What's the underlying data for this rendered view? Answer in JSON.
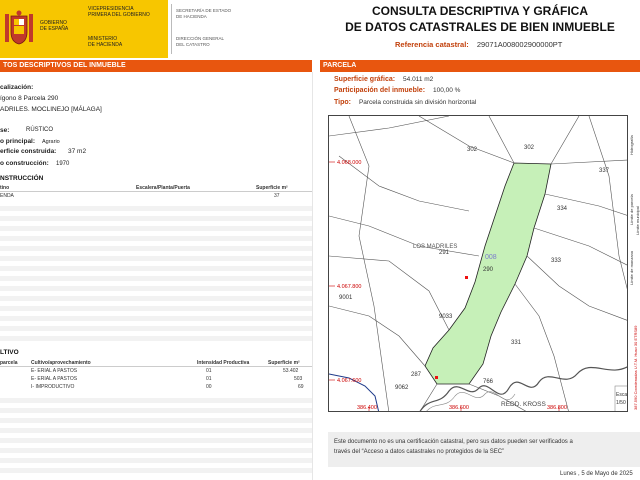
{
  "header": {
    "gov_line1": "GOBIERNO",
    "gov_line2": "DE ESPAÑA",
    "vice_line1": "VICEPRESIDENCIA",
    "vice_line2": "PRIMERA DEL GOBIERNO",
    "ministry_line1": "MINISTERIO",
    "ministry_line2": "DE HACIENDA",
    "sec_line1": "SECRETARÍA DE ESTADO",
    "sec_line2": "DE HACIENDA",
    "dir_line1": "DIRECCIÓN GENERAL",
    "dir_line2": "DEL CATASTRO",
    "title_line1": "CONSULTA DESCRIPTIVA Y GRÁFICA",
    "title_line2": "DE DATOS CATASTRALES DE BIEN INMUEBLE",
    "ref_label": "Referencia catastral:",
    "ref_value": "29071A008002900000PT",
    "brand_color": "#f7c600",
    "accent_color": "#e8560f"
  },
  "left": {
    "section_title": "TOS DESCRIPTIVOS DEL INMUEBLE",
    "location_label": "calización:",
    "location_line1": "ígono 8 Parcela 290",
    "location_line2": "ADRILES. MOCLINEJO [MÁLAGA]",
    "class_label": "se:",
    "class_value": "RÚSTICO",
    "use_label": "o principal:",
    "use_value": "Agrario",
    "area_label": "erficie construida:",
    "area_value": "37 m2",
    "year_label": "o construcción:",
    "year_value": "1970",
    "construction_title": "NSTRUCCIÓN",
    "construction_headers": [
      "tino",
      "Escalera/Planta/Puerta",
      "Superficie m²"
    ],
    "construction_rows": [
      [
        "ENDA",
        "",
        "37"
      ]
    ],
    "crop_title": "LTIVO",
    "crop_headers": [
      "parcela",
      "Cultivo/aprovechamiento",
      "Intensidad Productiva",
      "Superficie m²"
    ],
    "crop_rows": [
      [
        "",
        "E- ERIAL A PASTOS",
        "01",
        "53.402"
      ],
      [
        "",
        "E- ERIAL A PASTOS",
        "01",
        "503"
      ],
      [
        "",
        "I- IMPRODUCTIVO",
        "00",
        "69"
      ]
    ]
  },
  "right": {
    "section_title": "PARCELA",
    "graphic_area_label": "Superficie gráfica:",
    "graphic_area_value": "54.011 m2",
    "participation_label": "Participación del inmueble:",
    "participation_value": "100,00 %",
    "type_label": "Tipo:",
    "type_value": "Parcela construida sin división horizontal"
  },
  "map": {
    "parcel_numbers": [
      "302",
      "302",
      "337",
      "334",
      "333",
      "331",
      "291",
      "290",
      "9001",
      "9033",
      "766",
      "287",
      "9062"
    ],
    "highlight_label": "008",
    "place_label": "LOS MADRILES",
    "road_label": "REDD. KROSS",
    "y_coords": [
      "4.068.000",
      "4.067.800",
      "4.067.600"
    ],
    "x_coords": [
      "386.400",
      "386.600",
      "386.800"
    ],
    "legend_items": [
      "Hidrografía",
      "Límite de parcela",
      "Límite de manzana",
      "Límite municipal"
    ],
    "crs_text": "387.590 Coordenadas U.T.M. Huso 30 ETRS89",
    "scale_label1": "Esca",
    "scale_label2": "1/50",
    "parcel_color": "#c6f0b8"
  },
  "footer": {
    "note_line1": "Este documento no es una certificación catastral, pero sus datos pueden ser verificados a",
    "note_line2": "través del “Acceso a datos catastrales no protegidos de la SEC”",
    "date": "Lunes , 5 de Mayo de 2025"
  }
}
